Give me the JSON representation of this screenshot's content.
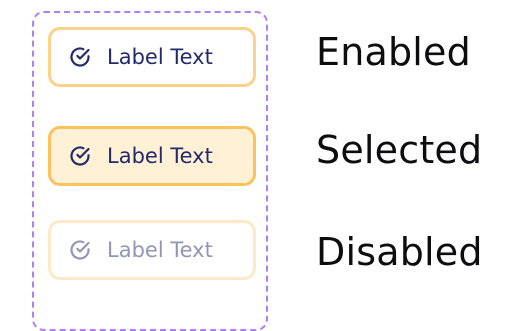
{
  "chips": [
    {
      "state": "enabled",
      "label": "Label Text",
      "icon": "check-circle-icon"
    },
    {
      "state": "selected",
      "label": "Label Text",
      "icon": "check-circle-icon"
    },
    {
      "state": "disabled",
      "label": "Label Text",
      "icon": "check-circle-icon"
    }
  ],
  "states": {
    "enabled": "Enabled",
    "selected": "Selected",
    "disabled": "Disabled"
  },
  "colors": {
    "frame_dash": "#b57cf5",
    "enabled_border": "#fcd18a",
    "selected_border": "#fdc15e",
    "selected_fill": "#fff1d6",
    "disabled_border": "#fde9c7",
    "text_dark": "#232a6b",
    "text_disabled": "#9296b4"
  }
}
